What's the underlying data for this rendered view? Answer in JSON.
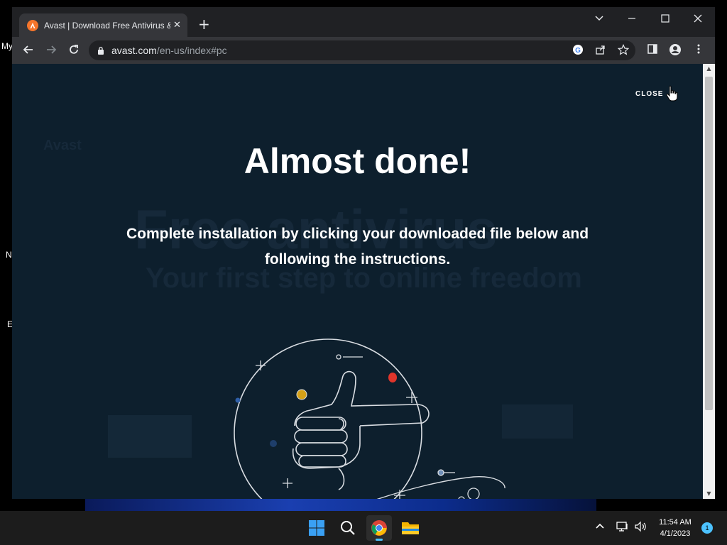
{
  "desktop": {
    "labels": [
      "My",
      "N",
      "E"
    ]
  },
  "browser": {
    "tab": {
      "title": "Avast | Download Free Antivirus &",
      "favicon": "avast-logo-icon"
    },
    "new_tab_icon": "plus-icon",
    "url": {
      "domain": "avast.com",
      "path": "/en-us/index#pc"
    }
  },
  "page": {
    "close_label": "CLOSE",
    "headline": "Almost done!",
    "subtext": "Complete installation by clicking your downloaded file below and following the instructions.",
    "background_headline": "Free antivirus",
    "background_subheadline": "Your first step to online freedom",
    "background_brand": "Avast",
    "colors": {
      "background": "#0d1f2d",
      "accent_yellow": "#d4a017",
      "accent_red": "#e0352b",
      "accent_green": "#3aa52a"
    }
  },
  "taskbar": {
    "apps": [
      "windows-start-icon",
      "search-icon",
      "chrome-icon",
      "file-explorer-icon"
    ],
    "time": "11:54 AM",
    "date": "4/1/2023",
    "notification_count": "1"
  }
}
